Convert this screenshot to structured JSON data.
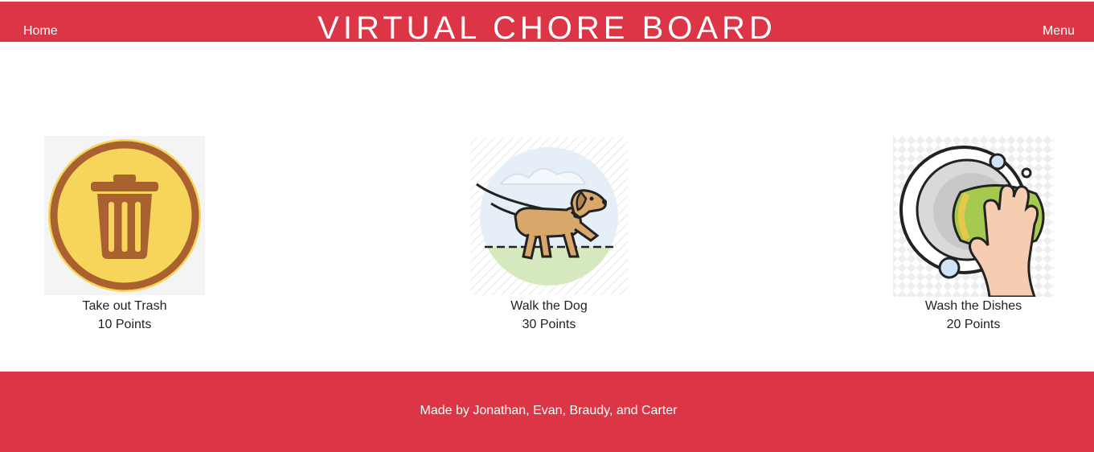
{
  "header": {
    "home_label": "Home",
    "title": "VIRTUAL CHORE BOARD",
    "menu_label": "Menu"
  },
  "chores": [
    {
      "name": "Take out Trash",
      "points": "10 Points",
      "icon": "trash-can-icon"
    },
    {
      "name": "Walk the Dog",
      "points": "30 Points",
      "icon": "dog-walk-icon"
    },
    {
      "name": "Wash the Dishes",
      "points": "20 Points",
      "icon": "wash-dishes-icon"
    }
  ],
  "footer": {
    "credits": "Made by Jonathan, Evan, Braudy, and Carter"
  },
  "colors": {
    "brand_red": "#dc3545",
    "text": "#222222",
    "white": "#ffffff"
  }
}
